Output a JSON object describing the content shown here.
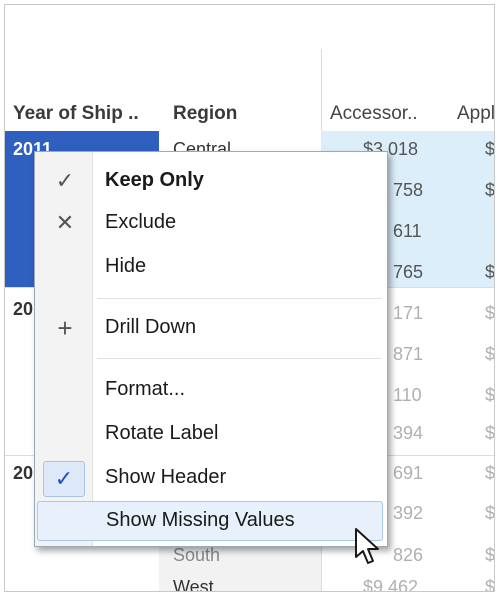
{
  "table": {
    "headers": {
      "year": "Year of Ship ..",
      "region": "Region",
      "col1": "Accessor..",
      "col2": "Appl"
    },
    "year_2011": "2011",
    "year_2012_partial": "20",
    "year_2013_partial": "20",
    "region_top": "Central",
    "region_south": "South",
    "region_west": "West",
    "col1_values": [
      "$3,018",
      "758",
      "611",
      "765",
      "171",
      "871",
      "110",
      "394",
      "691",
      "392",
      "826",
      "$9,462"
    ],
    "col2_values": [
      "$",
      "$",
      "",
      "$",
      "$",
      "$",
      "$",
      "$",
      "$",
      "$",
      "$",
      "$"
    ]
  },
  "menu": {
    "items": [
      {
        "label": "Keep Only",
        "icon": "check-icon",
        "glyph": "✓",
        "bold": true
      },
      {
        "label": "Exclude",
        "icon": "x-icon",
        "glyph": "✕"
      },
      {
        "label": "Hide",
        "icon": "",
        "glyph": ""
      },
      {
        "label": "Drill Down",
        "icon": "plus-icon",
        "glyph": "+"
      },
      {
        "label": "Format...",
        "icon": "",
        "glyph": ""
      },
      {
        "label": "Rotate Label",
        "icon": "",
        "glyph": ""
      },
      {
        "label": "Show Header",
        "icon": "check-icon",
        "glyph": "✓",
        "checked": true
      },
      {
        "label": "Show Missing Values",
        "icon": "",
        "glyph": "",
        "hovered": true
      }
    ]
  },
  "colors": {
    "selection": "#2f5fbf",
    "highlight": "#dbeefa",
    "check_blue": "#1f4fd1"
  }
}
